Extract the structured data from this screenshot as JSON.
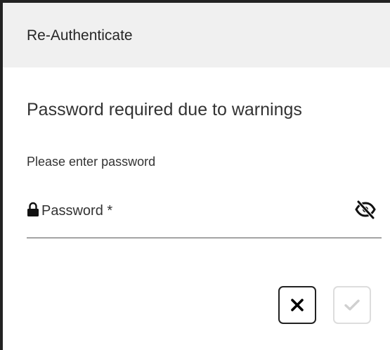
{
  "dialog": {
    "title": "Re-Authenticate",
    "message": "Password required due to warnings",
    "prompt": "Please enter password"
  },
  "password_field": {
    "placeholder": "Password *",
    "value": "",
    "lock_icon": "lock-icon",
    "toggle_icon": "eye-slash-icon"
  },
  "actions": {
    "cancel_icon": "close-icon",
    "confirm_icon": "checkmark-icon",
    "confirm_enabled": false
  },
  "colors": {
    "header_background": "#f0f0f0",
    "text": "#333333",
    "border": "#222222",
    "disabled": "#d0d0d0"
  }
}
